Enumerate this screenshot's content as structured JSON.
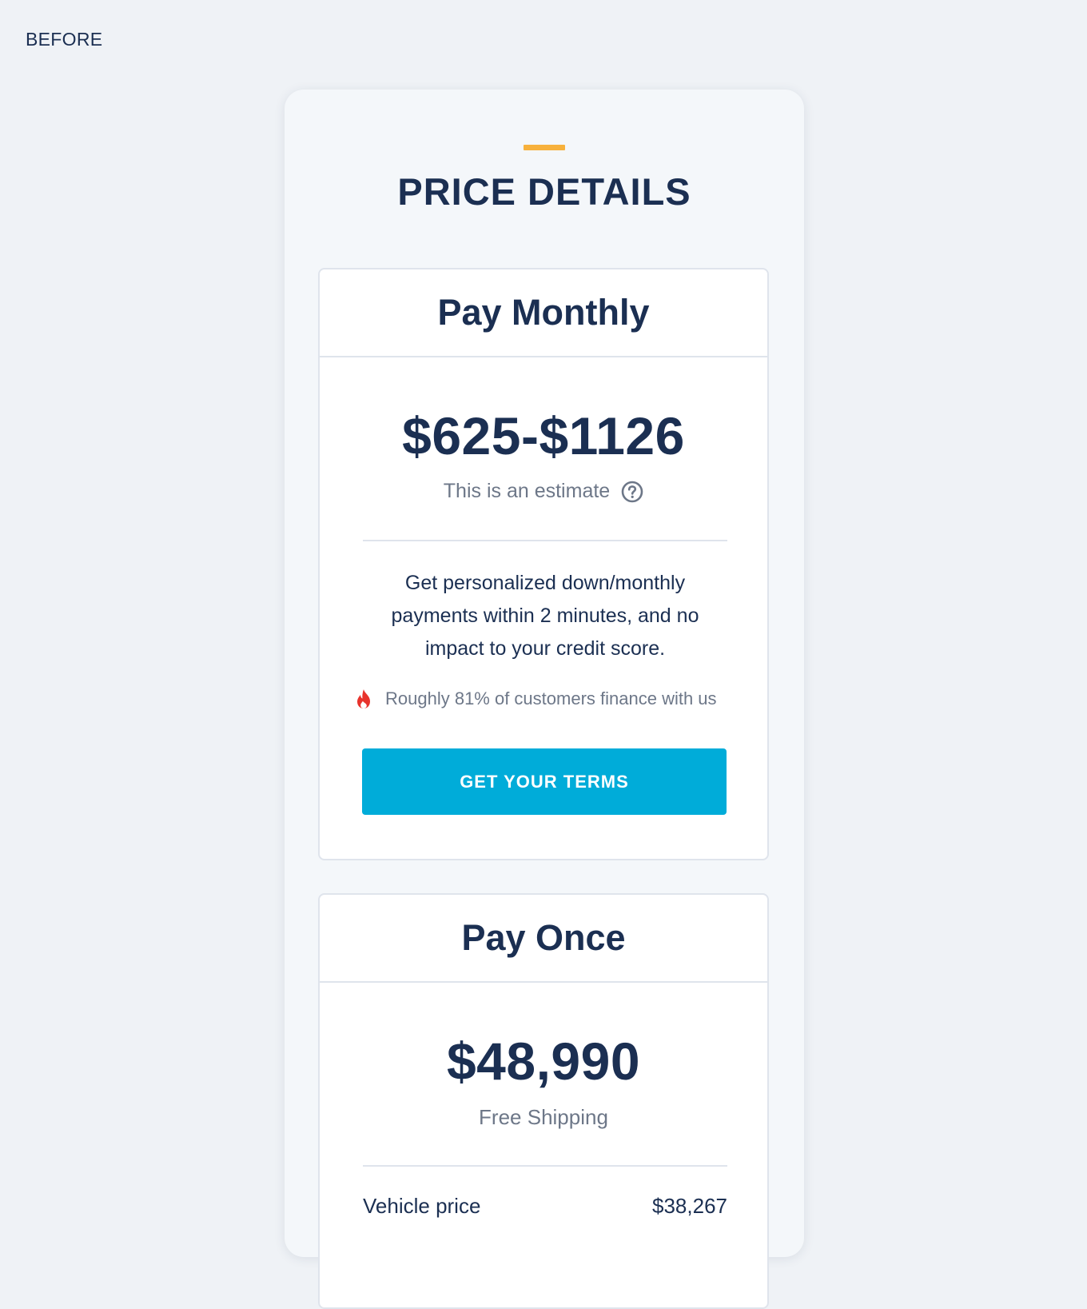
{
  "page": {
    "label": "BEFORE"
  },
  "price_details": {
    "title": "PRICE DETAILS",
    "accent_color": "#f7b13c"
  },
  "pay_monthly": {
    "title": "Pay Monthly",
    "price": "$625-$1126",
    "estimate_text": "This is an estimate",
    "help_icon": "question-circle-icon",
    "description": "Get personalized down/monthly payments within 2 minutes, and no impact to your credit score.",
    "hint_icon": "fire-icon",
    "hint_text": "Roughly 81% of customers finance with us",
    "cta_label": "GET YOUR TERMS",
    "cta_color": "#00acd9"
  },
  "pay_once": {
    "title": "Pay Once",
    "price": "$48,990",
    "shipping_text": "Free Shipping",
    "line_items": [
      {
        "label": "Vehicle price",
        "value": "$38,267"
      }
    ]
  }
}
